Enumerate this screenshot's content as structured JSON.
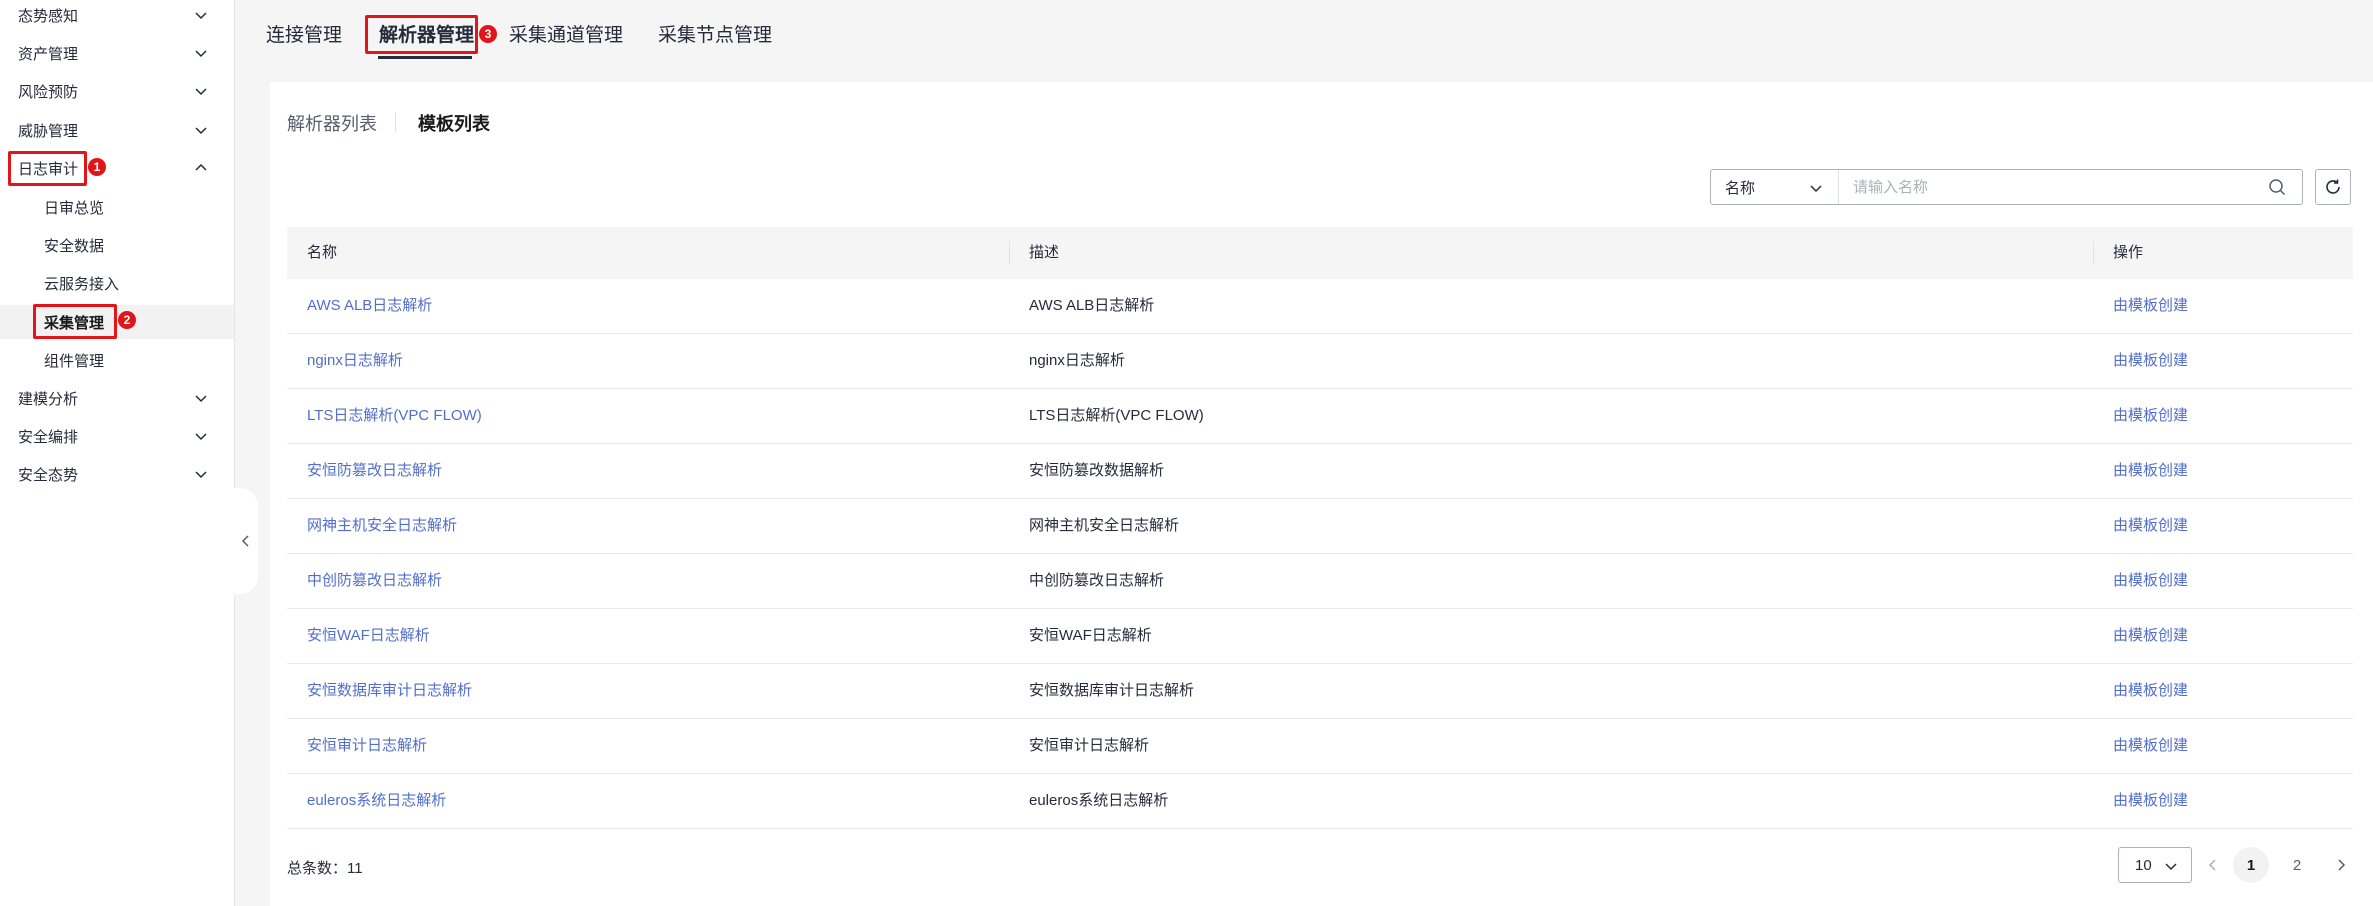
{
  "sidebar": {
    "items": [
      {
        "label": "态势感知"
      },
      {
        "label": "资产管理"
      },
      {
        "label": "风险预防"
      },
      {
        "label": "威胁管理"
      },
      {
        "label": "日志审计"
      },
      {
        "label": "建模分析"
      },
      {
        "label": "安全编排"
      },
      {
        "label": "安全态势"
      }
    ],
    "subitems": [
      {
        "label": "日审总览"
      },
      {
        "label": "安全数据"
      },
      {
        "label": "云服务接入"
      },
      {
        "label": "采集管理"
      },
      {
        "label": "组件管理"
      }
    ]
  },
  "annotations": {
    "badge1": "1",
    "badge2": "2",
    "badge3": "3"
  },
  "top_tabs": [
    {
      "label": "连接管理"
    },
    {
      "label": "解析器管理"
    },
    {
      "label": "采集通道管理"
    },
    {
      "label": "采集节点管理"
    }
  ],
  "sub_tabs": [
    {
      "label": "解析器列表"
    },
    {
      "label": "模板列表"
    }
  ],
  "search": {
    "field": "名称",
    "placeholder": "请输入名称"
  },
  "table": {
    "headers": {
      "name": "名称",
      "desc": "描述",
      "ops": "操作"
    },
    "rows": [
      {
        "name": "AWS ALB日志解析",
        "desc": "AWS ALB日志解析",
        "action": "由模板创建"
      },
      {
        "name": "nginx日志解析",
        "desc": "nginx日志解析",
        "action": "由模板创建"
      },
      {
        "name": "LTS日志解析(VPC FLOW)",
        "desc": "LTS日志解析(VPC FLOW)",
        "action": "由模板创建"
      },
      {
        "name": "安恒防篡改日志解析",
        "desc": "安恒防篡改数据解析",
        "action": "由模板创建"
      },
      {
        "name": "网神主机安全日志解析",
        "desc": "网神主机安全日志解析",
        "action": "由模板创建"
      },
      {
        "name": "中创防篡改日志解析",
        "desc": "中创防篡改日志解析",
        "action": "由模板创建"
      },
      {
        "name": "安恒WAF日志解析",
        "desc": "安恒WAF日志解析",
        "action": "由模板创建"
      },
      {
        "name": "安恒数据库审计日志解析",
        "desc": "安恒数据库审计日志解析",
        "action": "由模板创建"
      },
      {
        "name": "安恒审计日志解析",
        "desc": "安恒审计日志解析",
        "action": "由模板创建"
      },
      {
        "name": "euleros系统日志解析",
        "desc": "euleros系统日志解析",
        "action": "由模板创建"
      }
    ]
  },
  "footer": {
    "total": "总条数：11",
    "page_size": "10",
    "pages": [
      "1",
      "2"
    ]
  },
  "colors": {
    "accent_link": "#526ecc",
    "highlight": "#e0161b"
  }
}
